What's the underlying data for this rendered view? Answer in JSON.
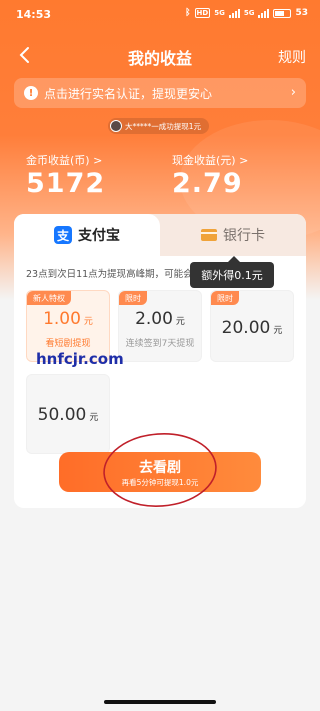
{
  "status_bar": {
    "time": "14:53",
    "hd_label": "HD",
    "net1": "5G",
    "net2": "5G",
    "battery": "53"
  },
  "nav": {
    "title": "我的收益",
    "rules_label": "规则"
  },
  "verify_banner": {
    "text": "点击进行实名认证，提现更安心",
    "info_glyph": "!"
  },
  "ticker": {
    "text": "大*****一成功提现1元"
  },
  "earnings": {
    "coin_label": "金币收益(币) >",
    "coin_value": "5172",
    "cash_label": "现金收益(元) >",
    "cash_value": "2.79"
  },
  "tabs": [
    {
      "label": "支付宝",
      "icon": "alipay-icon",
      "selected": true
    },
    {
      "label": "银行卡",
      "icon": "bank-card-icon",
      "selected": false
    }
  ],
  "notice": "23点到次日11点为提现高峰期，可能会",
  "tooltip": "额外得0.1元",
  "options": [
    {
      "badge": "新人特权",
      "amount": "1.00",
      "unit": "元",
      "sub": "看短剧提现",
      "selected": true
    },
    {
      "badge": "限时",
      "amount": "2.00",
      "unit": "元",
      "sub": "连续签到7天提现",
      "selected": false
    },
    {
      "badge": "限时",
      "amount": "20.00",
      "unit": "元",
      "sub": "",
      "selected": false
    },
    {
      "badge": "",
      "amount": "50.00",
      "unit": "元",
      "sub": "",
      "selected": false
    }
  ],
  "watch_button": {
    "title": "去看剧",
    "sub": "再看5分钟可提现1.0元"
  },
  "watermark": "hnfcjr.com",
  "colors": {
    "accent": "#ff7a2f",
    "alipay": "#1677ff",
    "annotation": "#c0202a",
    "watermark": "#1f2ea8"
  }
}
